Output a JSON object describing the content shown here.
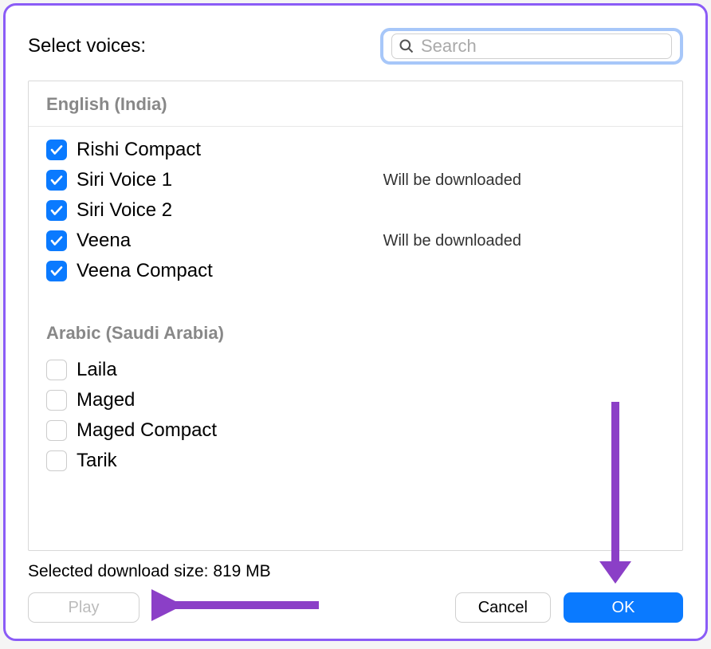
{
  "header": {
    "title": "Select voices:",
    "search_placeholder": "Search"
  },
  "groups": [
    {
      "name": "English (India)",
      "items": [
        {
          "label": "Rishi Compact",
          "checked": true,
          "status": ""
        },
        {
          "label": "Siri Voice 1",
          "checked": true,
          "status": "Will be downloaded"
        },
        {
          "label": "Siri Voice 2",
          "checked": true,
          "status": ""
        },
        {
          "label": "Veena",
          "checked": true,
          "status": "Will be downloaded"
        },
        {
          "label": "Veena Compact",
          "checked": true,
          "status": ""
        }
      ]
    },
    {
      "name": "Arabic (Saudi Arabia)",
      "items": [
        {
          "label": "Laila",
          "checked": false,
          "status": ""
        },
        {
          "label": "Maged",
          "checked": false,
          "status": ""
        },
        {
          "label": "Maged Compact",
          "checked": false,
          "status": ""
        },
        {
          "label": "Tarik",
          "checked": false,
          "status": ""
        }
      ]
    }
  ],
  "footer": {
    "size_label": "Selected download size: 819 MB",
    "play": "Play",
    "cancel": "Cancel",
    "ok": "OK"
  },
  "colors": {
    "accent": "#0a7aff",
    "annotation": "#8b3fc7"
  }
}
